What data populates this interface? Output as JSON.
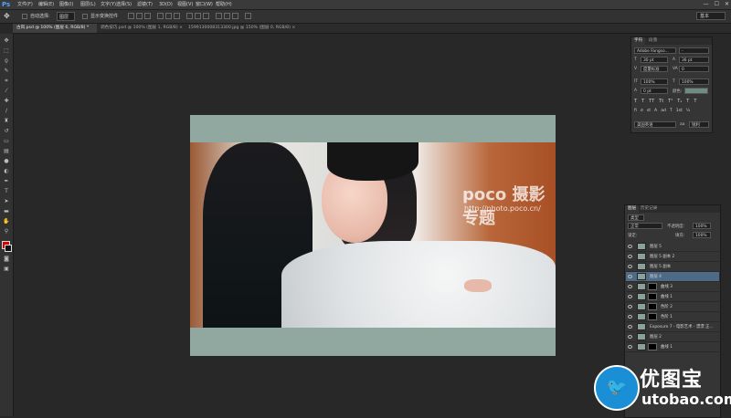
{
  "app": {
    "logo": "Ps"
  },
  "menu": [
    "文件(F)",
    "编辑(E)",
    "图像(I)",
    "图层(L)",
    "文字(Y)",
    "选择(S)",
    "滤镜(T)",
    "3D(D)",
    "视图(V)",
    "窗口(W)",
    "帮助(H)"
  ],
  "window_controls": [
    "—",
    "☐",
    "✕"
  ],
  "options": {
    "auto_select": "自动选择:",
    "auto_select_value": "图层",
    "show_transform": "显示变换控件",
    "workspace": "基本"
  },
  "tabs": [
    "古风.psd @ 100% (图层 6, RGB/8) *",
    "调色技巧.psd @ 100% (图层 1, RGB/8) ×",
    "1599130008313300.jpg @ 150% (图层 0, RGB/8) ×"
  ],
  "char_panel": {
    "tabs": [
      "字符",
      "段落"
    ],
    "font": "Adobe Fangso...",
    "style": "-",
    "size": "30 pt",
    "leading": "36 pt",
    "kerning": "度量标准",
    "tracking": "0",
    "vscale": "100%",
    "hscale": "100%",
    "baseline": "0 pt",
    "color_label": "颜色:",
    "language": "美国英语",
    "aa": "锐利",
    "styles": [
      "T",
      "T",
      "TT",
      "Tt",
      "T¹",
      "T₁",
      "T",
      "T"
    ],
    "opentype": [
      "fi",
      "σ",
      "st",
      "A",
      "ad",
      "T",
      "1st",
      "½"
    ]
  },
  "layer_panel": {
    "tabs": [
      "图层",
      "历史记录"
    ],
    "kind": "类型",
    "blend_mode": "正常",
    "opacity_label": "不透明度:",
    "opacity": "100%",
    "lock_label": "锁定:",
    "fill_label": "填充:",
    "fill": "100%",
    "layers": [
      {
        "name": "图层 5",
        "selected": false,
        "mask": false
      },
      {
        "name": "图层 5 副本 2",
        "selected": false,
        "mask": false
      },
      {
        "name": "图层 5 副本",
        "selected": false,
        "mask": false
      },
      {
        "name": "图层 4",
        "selected": true,
        "mask": false
      },
      {
        "name": "曲线 3",
        "selected": false,
        "mask": true
      },
      {
        "name": "曲线 1",
        "selected": false,
        "mask": true
      },
      {
        "name": "色阶 2",
        "selected": false,
        "mask": true
      },
      {
        "name": "色阶 1",
        "selected": false,
        "mask": true
      },
      {
        "name": "Exposure 7 - 电影艺术 - 漂漂 正...",
        "selected": false,
        "mask": false
      },
      {
        "name": "图层 2",
        "selected": false,
        "mask": false
      },
      {
        "name": "曲线 1",
        "selected": false,
        "mask": true
      }
    ]
  },
  "canvas": {
    "watermark_logo": "poco 摄影专题",
    "watermark_url": "http://photo.poco.cn/"
  },
  "site_watermark": {
    "cn": "优图宝",
    "en": "utobao.com"
  }
}
